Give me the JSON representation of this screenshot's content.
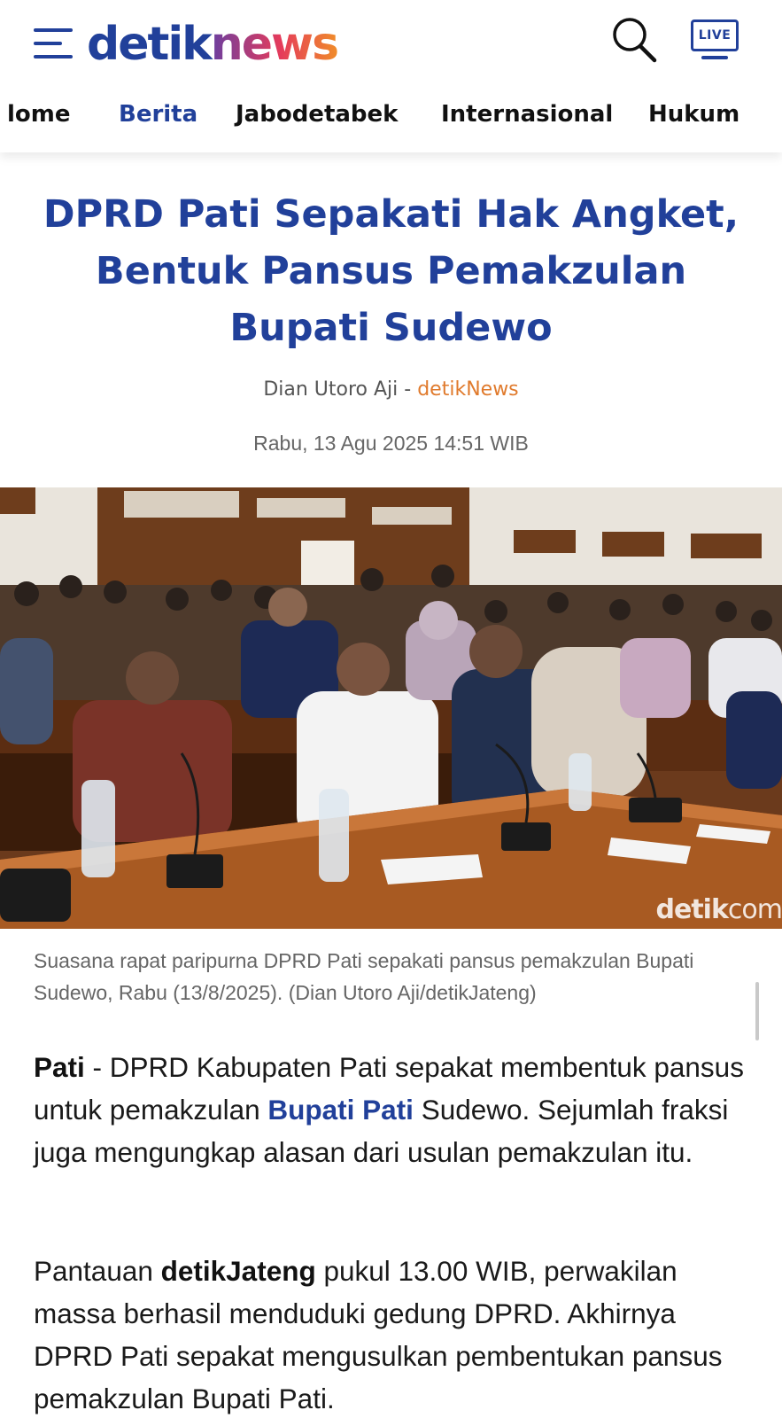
{
  "header": {
    "logo_detik": "detik",
    "logo_news": "news",
    "live_label": "LIVE"
  },
  "nav": {
    "items": [
      {
        "label": "Home",
        "visible_text": "lome"
      },
      {
        "label": "Berita",
        "visible_text": "Berita",
        "active": true
      },
      {
        "label": "Jabodetabek",
        "visible_text": "Jabodetabek"
      },
      {
        "label": "Internasional",
        "visible_text": "Internasional"
      },
      {
        "label": "Hukum",
        "visible_text": "Hukum"
      }
    ]
  },
  "article": {
    "title": "DPRD Pati Sepakati Hak Angket, Bentuk Pansus Pemakzulan Bupati Sudewo",
    "author": "Dian Utoro Aji",
    "separator": " - ",
    "source": "detikNews",
    "date": "Rabu, 13 Agu 2025 14:51 WIB",
    "image": {
      "watermark_bold": "detik",
      "watermark_rest": "com",
      "caption": "Suasana rapat paripurna DPRD Pati sepakati pansus pemakzulan Bupati Sudewo, Rabu (13/8/2025). (Dian Utoro Aji/detikJateng)"
    },
    "p1": {
      "dateline": "Pati",
      "text_a": " - DPRD Kabupaten Pati sepakat membentuk pansus untuk pemakzulan ",
      "link": "Bupati Pati",
      "text_b": " Sudewo. Sejumlah fraksi juga mengungkap alasan dari usulan pemakzulan itu."
    },
    "p2": {
      "text_a": "Pantauan ",
      "bold": "detikJateng",
      "text_b": " pukul 13.00 WIB, perwakilan massa berhasil menduduki gedung DPRD. Akhirnya DPRD Pati sepakat mengusulkan pembentukan pansus pemakzulan Bupati Pati."
    }
  },
  "colors": {
    "brand_blue": "#21409a",
    "source_orange": "#e07a2c"
  }
}
